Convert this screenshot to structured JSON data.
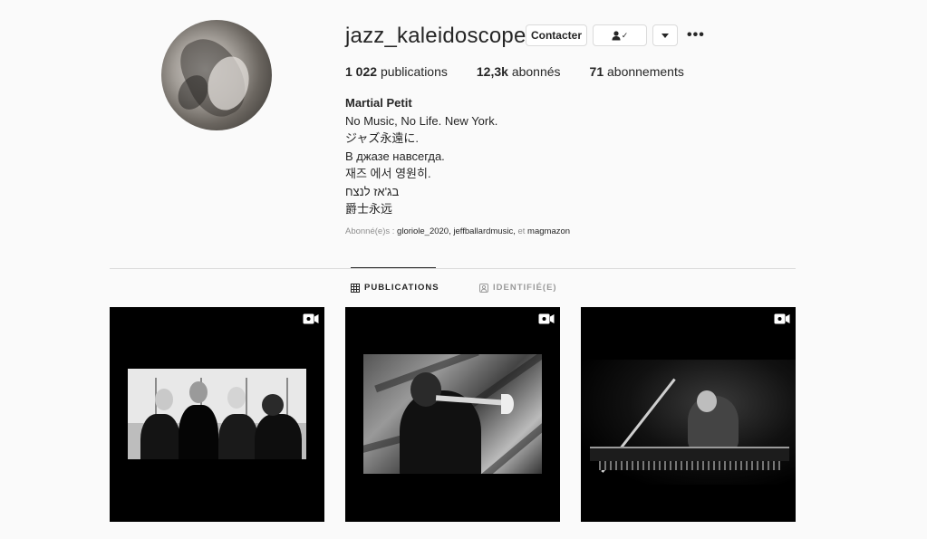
{
  "profile": {
    "username": "jazz_kaleidoscope",
    "buttons": {
      "contact": "Contacter",
      "follow_icon": "✓"
    },
    "more": "•••",
    "stats": [
      {
        "value": "1 022",
        "label": "publications"
      },
      {
        "value": "12,3k",
        "label": "abonnés"
      },
      {
        "value": "71",
        "label": "abonnements"
      }
    ],
    "bio": {
      "name": "Martial Petit",
      "lines": [
        "No Music, No Life. New York.",
        "ジャズ永遠に.",
        "В джазе навсегда.",
        "재즈 에서 영원히.",
        "בג'אז לנצח",
        "爵士永远"
      ]
    },
    "followed_by": {
      "prefix": "Abonné(e)s : ",
      "names": "gloriole_2020, jeffballardmusic,",
      "conjunction": " et ",
      "last": "magmazon"
    }
  },
  "tabs": [
    {
      "label": "PUBLICATIONS",
      "active": true
    },
    {
      "label": "IDENTIFIÉ(E)",
      "active": false
    }
  ],
  "posts": [
    {
      "type": "video",
      "subject": "band-photo"
    },
    {
      "type": "video",
      "subject": "trumpet-player-photo"
    },
    {
      "type": "video",
      "subject": "pianist-photo"
    }
  ],
  "colors": {
    "background": "#fafafa",
    "text": "#262626",
    "muted": "#8e8e8e",
    "border": "#dbdbdb"
  }
}
